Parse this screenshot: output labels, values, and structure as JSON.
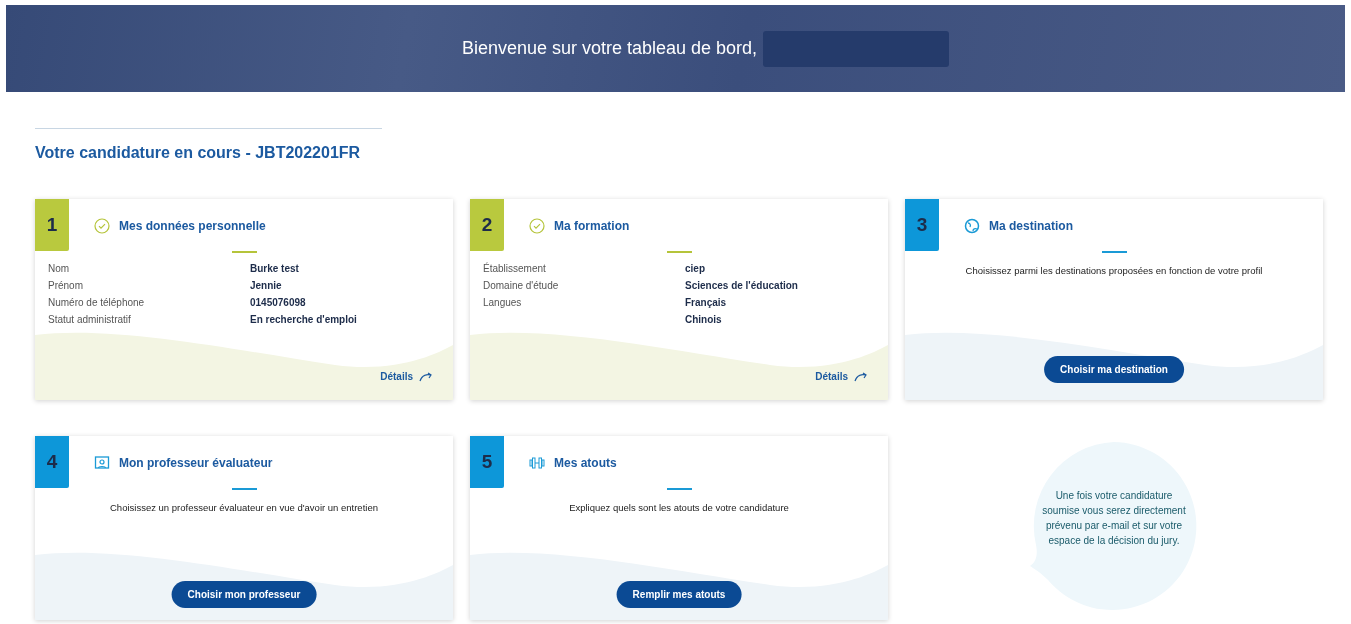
{
  "banner": {
    "greeting": "Bienvenue sur votre tableau de bord,"
  },
  "section_title": "Votre candidature en cours - JBT202201FR",
  "cards": [
    {
      "kind": "details",
      "number": "1",
      "title": "Mes données personnelle",
      "completed": true,
      "rows": [
        {
          "label": "Nom",
          "values": [
            "Burke test"
          ]
        },
        {
          "label": "Prénom",
          "values": [
            "Jennie"
          ]
        },
        {
          "label": "Numéro de téléphone",
          "values": [
            "0145076098"
          ]
        },
        {
          "label": "Statut administratif",
          "values": [
            "En recherche d'emploi"
          ]
        }
      ],
      "link": "Détails"
    },
    {
      "kind": "details",
      "number": "2",
      "title": "Ma formation",
      "completed": true,
      "rows": [
        {
          "label": "Établissement",
          "values": [
            "ciep"
          ]
        },
        {
          "label": "Domaine d'étude",
          "values": [
            "Sciences de l'éducation"
          ]
        },
        {
          "label": "Langues",
          "values": [
            "Français",
            "Chinois"
          ]
        }
      ],
      "link": "Détails"
    },
    {
      "kind": "action",
      "number": "3",
      "title": "Ma destination",
      "completed": false,
      "text": "Choisissez parmi les destinations proposées en fonction de votre profil",
      "button": "Choisir ma destination"
    },
    {
      "kind": "action",
      "number": "4",
      "title": "Mon professeur évaluateur",
      "completed": false,
      "text": "Choisissez un professeur évaluateur en vue d'avoir un entretien",
      "button": "Choisir mon professeur"
    },
    {
      "kind": "action",
      "number": "5",
      "title": "Mes atouts",
      "completed": false,
      "text": "Expliquez quels sont les atouts de votre candidature",
      "button": "Remplir mes atouts"
    }
  ],
  "info_bubble": "Une fois votre candidature soumise vous serez directement prévenu par e-mail et sur votre espace de la décision du jury."
}
